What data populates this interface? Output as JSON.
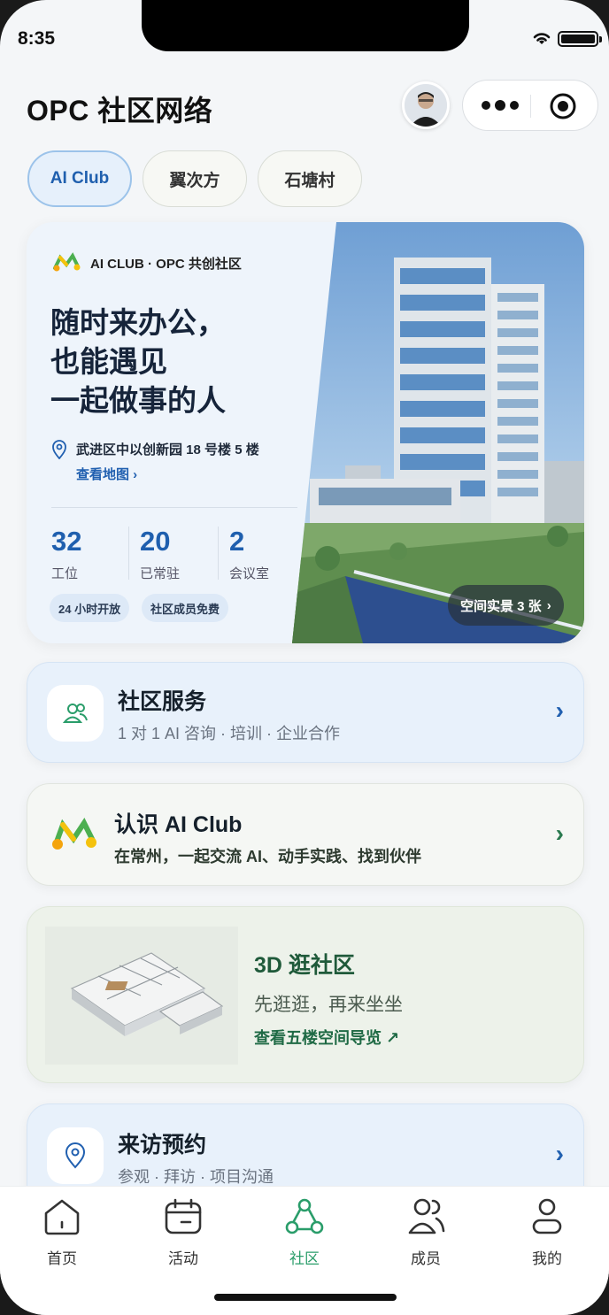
{
  "status_bar": {
    "time": "8:35"
  },
  "header": {
    "title": "OPC 社区网络"
  },
  "tabs": [
    {
      "label": "AI Club",
      "active": true
    },
    {
      "label": "翼次方",
      "active": false
    },
    {
      "label": "石塘村",
      "active": false
    }
  ],
  "hero": {
    "brand": "AI CLUB · OPC 共创社区",
    "headline": "随时来办公，\n也能遇见\n一起做事的人",
    "location": "武进区中以创新园 18 号楼 5 楼",
    "map_link": "查看地图 ›",
    "stats": [
      {
        "value": "32",
        "label": "工位"
      },
      {
        "value": "20",
        "label": "已常驻"
      },
      {
        "value": "2",
        "label": "会议室"
      }
    ],
    "chips": [
      "24 小时开放",
      "社区成员免费"
    ],
    "photos_button": "空间实景 3 张"
  },
  "cards": {
    "services": {
      "title": "社区服务",
      "subtitle": "1 对 1 AI 咨询 · 培训 · 企业合作",
      "chevron": "›"
    },
    "about": {
      "title": "认识 AI Club",
      "subtitle": "在常州，一起交流 AI、动手实践、找到伙伴",
      "chevron": "›"
    },
    "tour3d": {
      "title": "3D 逛社区",
      "subtitle": "先逛逛，再来坐坐",
      "link": "查看五楼空间导览 ↗"
    },
    "visit": {
      "title": "来访预约",
      "subtitle": "参观 · 拜访 · 项目沟通",
      "chevron": "›"
    }
  },
  "tabbar": [
    {
      "label": "首页",
      "icon": "home-icon",
      "active": false
    },
    {
      "label": "活动",
      "icon": "calendar-icon",
      "active": false
    },
    {
      "label": "社区",
      "icon": "community-icon",
      "active": true
    },
    {
      "label": "成员",
      "icon": "members-icon",
      "active": false
    },
    {
      "label": "我的",
      "icon": "profile-icon",
      "active": false
    }
  ],
  "colors": {
    "accent_blue": "#1f5fae",
    "accent_green": "#2a9d6a",
    "service_card": "#e8f1fb",
    "tour_card": "#edf2ea"
  }
}
